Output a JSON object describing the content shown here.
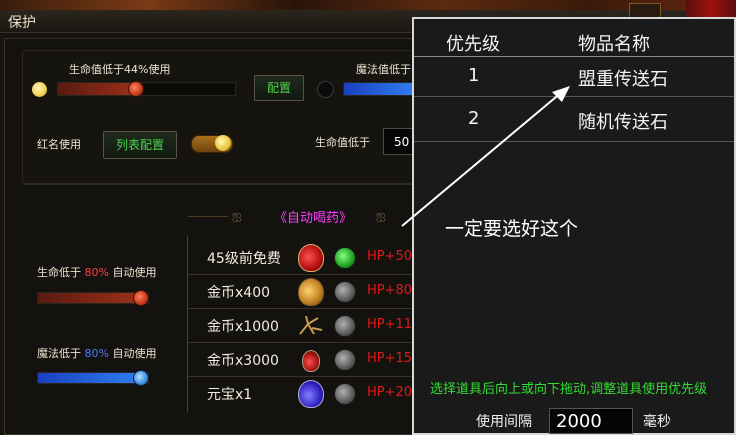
{
  "window": {
    "title": "保护"
  },
  "protect": {
    "hp_use_label": "生命值低于44%使用",
    "hp_use_percent": 44,
    "config_button": "配置",
    "mp_use_label": "魔法值低于",
    "hp_below_label": "生命值低于",
    "hp_below_value": "50",
    "red_name_label": "红名使用",
    "list_config_button": "列表配置",
    "red_name_toggle": true
  },
  "auto_potion": {
    "title": "《自动喝药》",
    "hp_rule": {
      "prefix": "生命低于",
      "percent": "80%",
      "suffix": "自动使用",
      "percent_color": "#ff4040",
      "value": 0.8
    },
    "mp_rule": {
      "prefix": "魔法低于",
      "percent": "80%",
      "suffix": "自动使用",
      "percent_color": "#4a7cff",
      "value": 0.8
    },
    "items": [
      {
        "name": "45级前免费",
        "hp": "HP+50",
        "icon": "red-potion-icon",
        "selected": true
      },
      {
        "name": "金币x400",
        "hp": "HP+80",
        "icon": "gold-potion-icon",
        "selected": false
      },
      {
        "name": "金币x1000",
        "hp": "HP+11",
        "icon": "root-herb-icon",
        "selected": false
      },
      {
        "name": "金币x3000",
        "hp": "HP+15",
        "icon": "small-red-potion-icon",
        "selected": false
      },
      {
        "name": "元宝x1",
        "hp": "HP+20",
        "icon": "purple-potion-icon",
        "selected": false
      }
    ]
  },
  "priority_table": {
    "col_priority": "优先级",
    "col_item": "物品名称",
    "rows": [
      {
        "priority": "1",
        "item": "盟重传送石"
      },
      {
        "priority": "2",
        "item": "随机传送石"
      }
    ],
    "annotation": "一定要选好这个",
    "hint": "选择道具后向上或向下拖动,调整道具使用优先级",
    "interval_label": "使用间隔",
    "interval_value": "2000",
    "interval_unit": "毫秒"
  },
  "colors": {
    "accent_green": "#33dd33",
    "hp_red": "#e01818",
    "annotation_white": "#ffffff"
  }
}
